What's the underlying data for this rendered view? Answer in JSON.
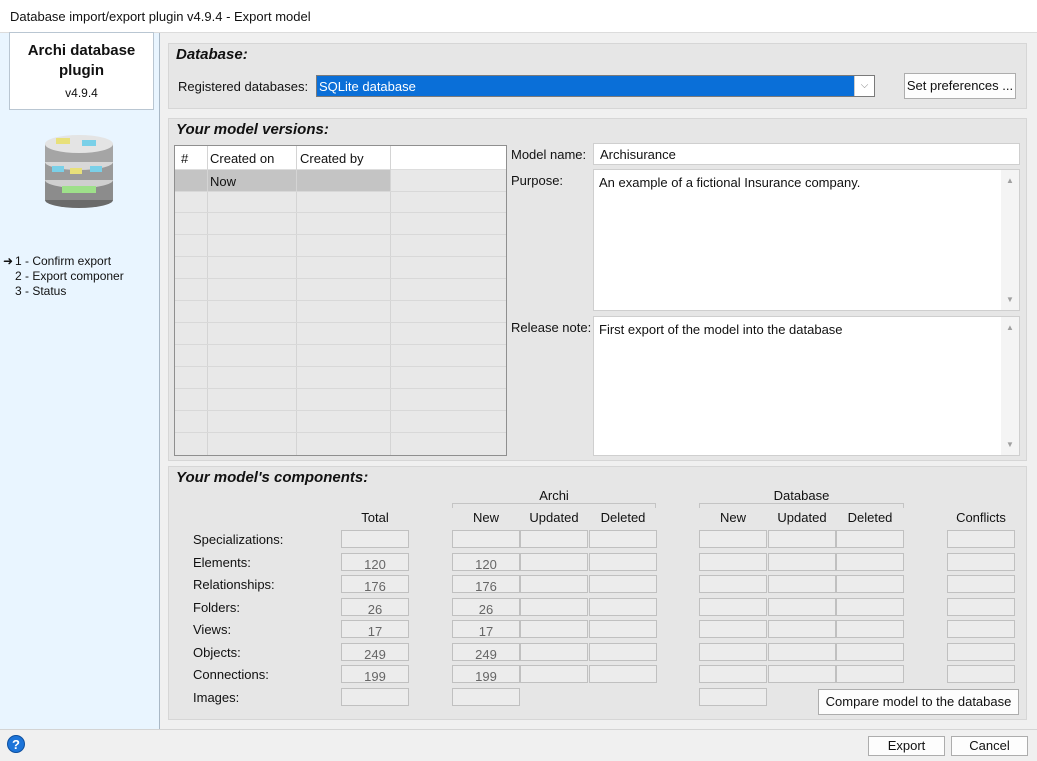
{
  "window": {
    "title": "Database import/export plugin v4.9.4 - Export model"
  },
  "sidebar": {
    "plugin_title": "Archi database plugin",
    "plugin_version": "v4.9.4",
    "icon": "database-icon",
    "steps": [
      {
        "marker": "➜",
        "label": "1 - Confirm export"
      },
      {
        "marker": "",
        "label": "2 - Export componer"
      },
      {
        "marker": "",
        "label": "3 - Status"
      }
    ]
  },
  "database": {
    "section_title": "Database:",
    "registered_label": "Registered databases:",
    "selected_database": "SQLite database",
    "set_preferences_label": "Set preferences ..."
  },
  "versions": {
    "section_title": "Your model versions:",
    "columns": [
      "#",
      "Created on",
      "Created by"
    ],
    "rows": [
      {
        "num": "",
        "created_on": "Now",
        "created_by": ""
      }
    ],
    "model_name_label": "Model name:",
    "model_name_value": "Archisurance",
    "purpose_label": "Purpose:",
    "purpose_value": "An example of a fictional Insurance company.",
    "release_note_label": "Release note:",
    "release_note_value": "First export of the model into the database"
  },
  "components": {
    "section_title": "Your model's components:",
    "group_archi": "Archi",
    "group_database": "Database",
    "headers": {
      "total": "Total",
      "archi_new": "New",
      "archi_updated": "Updated",
      "archi_deleted": "Deleted",
      "db_new": "New",
      "db_updated": "Updated",
      "db_deleted": "Deleted",
      "conflicts": "Conflicts"
    },
    "rows": [
      {
        "label": "Specializations:",
        "total": "",
        "archi_new": ""
      },
      {
        "label": "Elements:",
        "total": "120",
        "archi_new": "120"
      },
      {
        "label": "Relationships:",
        "total": "176",
        "archi_new": "176"
      },
      {
        "label": "Folders:",
        "total": "26",
        "archi_new": "26"
      },
      {
        "label": "Views:",
        "total": "17",
        "archi_new": "17"
      },
      {
        "label": "Objects:",
        "total": "249",
        "archi_new": "249"
      },
      {
        "label": "Connections:",
        "total": "199",
        "archi_new": "199"
      },
      {
        "label": "Images:",
        "total": "",
        "archi_new": ""
      }
    ],
    "compare_button_label": "Compare model to the database"
  },
  "footer": {
    "export_label": "Export",
    "cancel_label": "Cancel",
    "help_icon": "help-icon"
  }
}
